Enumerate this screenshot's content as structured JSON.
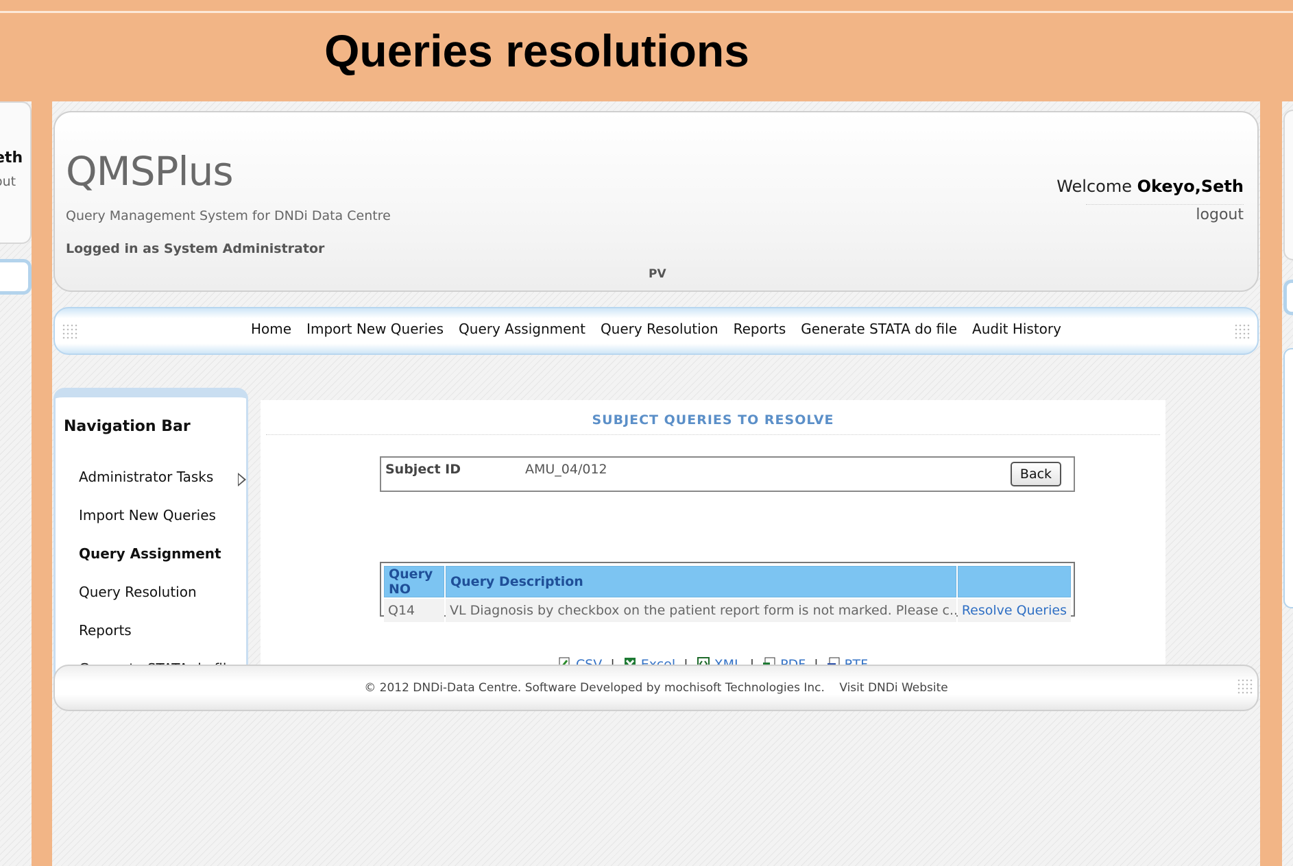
{
  "slide": {
    "title": "Queries resolutions"
  },
  "left_partial": {
    "name": "eth",
    "link": "out"
  },
  "app": {
    "logo": "QMSPlus",
    "subtitle": "Query Management System for DNDi Data Centre",
    "logged_in": "Logged in as System Administrator",
    "site_code": "PV",
    "welcome_prefix": "Welcome ",
    "user_name": "Okeyo,Seth",
    "logout": "logout"
  },
  "top_nav": [
    "Home",
    "Import New Queries",
    "Query Assignment",
    "Query Resolution",
    "Reports",
    "Generate STATA do file",
    "Audit History"
  ],
  "side_nav": {
    "title": "Navigation Bar",
    "items": [
      {
        "label": "Administrator Tasks",
        "submenu": true
      },
      {
        "label": "Import New Queries"
      },
      {
        "label": "Query Assignment",
        "active": true
      },
      {
        "label": "Query Resolution"
      },
      {
        "label": "Reports"
      },
      {
        "label": "Generate STATA do file"
      }
    ]
  },
  "content": {
    "title": "SUBJECT QUERIES TO RESOLVE",
    "subject_label": "Subject ID",
    "subject_value": "AMU_04/012",
    "back_label": "Back",
    "table": {
      "headers": [
        "Query NO",
        "Query Description",
        ""
      ],
      "rows": [
        {
          "no": "Q14",
          "description": "VL Diagnosis by checkbox on the patient report form is not marked. Please c...",
          "action": "Resolve Queries"
        }
      ]
    },
    "exports": [
      {
        "label": "CSV",
        "icon": "csv-icon"
      },
      {
        "label": "Excel",
        "icon": "excel-icon"
      },
      {
        "label": "XML",
        "icon": "xml-icon"
      },
      {
        "label": "PDF",
        "icon": "pdf-icon"
      },
      {
        "label": "RTF",
        "icon": "rtf-icon"
      }
    ]
  },
  "footer": {
    "copyright": "© 2012 DNDi-Data Centre. Software Developed by mochisoft Technologies Inc.",
    "link": "Visit DNDi Website"
  },
  "colors": {
    "slide_bg": "#f2b586",
    "table_header": "#7cc4f2",
    "link": "#2f6fc4",
    "section_title": "#5b8fc8"
  }
}
